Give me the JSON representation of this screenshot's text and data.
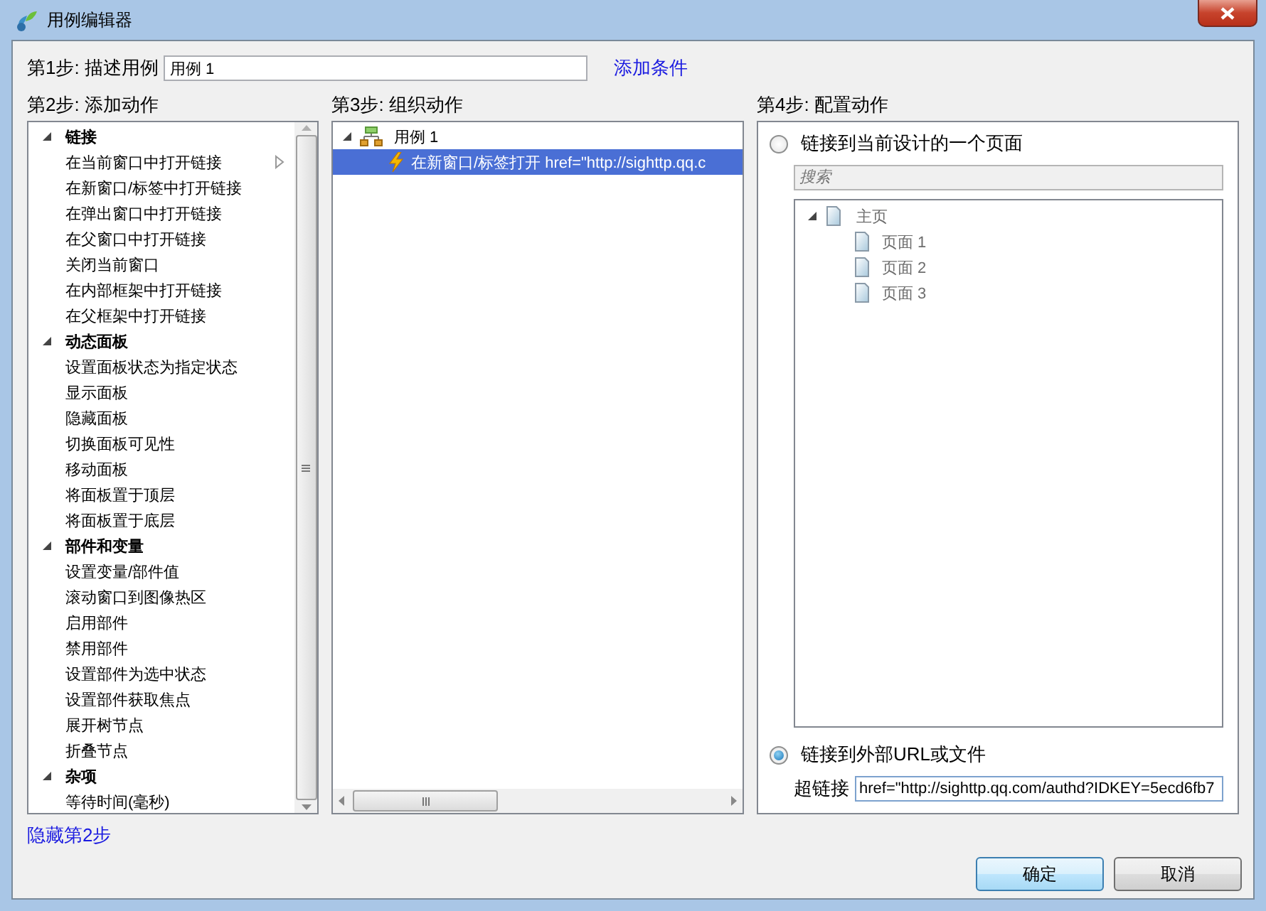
{
  "window": {
    "title": "用例编辑器"
  },
  "step1": {
    "label": "第1步: 描述用例",
    "value": "用例 1",
    "add_condition_link": "添加条件"
  },
  "step2": {
    "label": "第2步: 添加动作",
    "groups": [
      {
        "label": "链接",
        "expanded": true,
        "children": [
          {
            "label": "在当前窗口中打开链接",
            "hovered": true
          },
          {
            "label": "在新窗口/标签中打开链接",
            "hovered": false
          },
          {
            "label": "在弹出窗口中打开链接",
            "hovered": false
          },
          {
            "label": "在父窗口中打开链接",
            "hovered": false
          },
          {
            "label": "关闭当前窗口",
            "hovered": false
          },
          {
            "label": "在内部框架中打开链接",
            "hovered": false
          },
          {
            "label": "在父框架中打开链接",
            "hovered": false
          }
        ]
      },
      {
        "label": "动态面板",
        "expanded": true,
        "children": [
          {
            "label": "设置面板状态为指定状态",
            "hovered": false
          },
          {
            "label": "显示面板",
            "hovered": false
          },
          {
            "label": "隐藏面板",
            "hovered": false
          },
          {
            "label": "切换面板可见性",
            "hovered": false
          },
          {
            "label": "移动面板",
            "hovered": false
          },
          {
            "label": "将面板置于顶层",
            "hovered": false
          },
          {
            "label": "将面板置于底层",
            "hovered": false
          }
        ]
      },
      {
        "label": "部件和变量",
        "expanded": true,
        "children": [
          {
            "label": "设置变量/部件值",
            "hovered": false
          },
          {
            "label": "滚动窗口到图像热区",
            "hovered": false
          },
          {
            "label": "启用部件",
            "hovered": false
          },
          {
            "label": "禁用部件",
            "hovered": false
          },
          {
            "label": "设置部件为选中状态",
            "hovered": false
          },
          {
            "label": "设置部件获取焦点",
            "hovered": false
          },
          {
            "label": "展开树节点",
            "hovered": false
          },
          {
            "label": "折叠节点",
            "hovered": false
          }
        ]
      },
      {
        "label": "杂项",
        "expanded": true,
        "children": [
          {
            "label": "等待时间(毫秒)",
            "hovered": false
          }
        ]
      }
    ],
    "hide_link": "隐藏第2步"
  },
  "step3": {
    "label": "第3步: 组织动作",
    "tree": [
      {
        "label": "用例 1",
        "expanded": true,
        "selected": false,
        "children": [
          {
            "label": "在新窗口/标签打开 href=\"http://sighttp.qq.c",
            "selected": true
          }
        ]
      }
    ]
  },
  "step4": {
    "label": "第4步: 配置动作",
    "options": [
      {
        "label": "链接到当前设计的一个页面",
        "selected": false
      },
      {
        "label": "链接到外部URL或文件",
        "selected": true
      }
    ],
    "search": {
      "placeholder": "搜索"
    },
    "pages": [
      {
        "label": "主页",
        "expanded": true,
        "children": [
          {
            "label": "页面 1"
          },
          {
            "label": "页面 2"
          },
          {
            "label": "页面 3"
          }
        ]
      }
    ],
    "hyperlink": {
      "label": "超链接",
      "value": "href=\"http://sighttp.qq.com/authd?IDKEY=5ecd6fb7"
    }
  },
  "buttons": [
    {
      "label": "确定",
      "kind": "primary"
    },
    {
      "label": "取消",
      "kind": "normal"
    }
  ]
}
